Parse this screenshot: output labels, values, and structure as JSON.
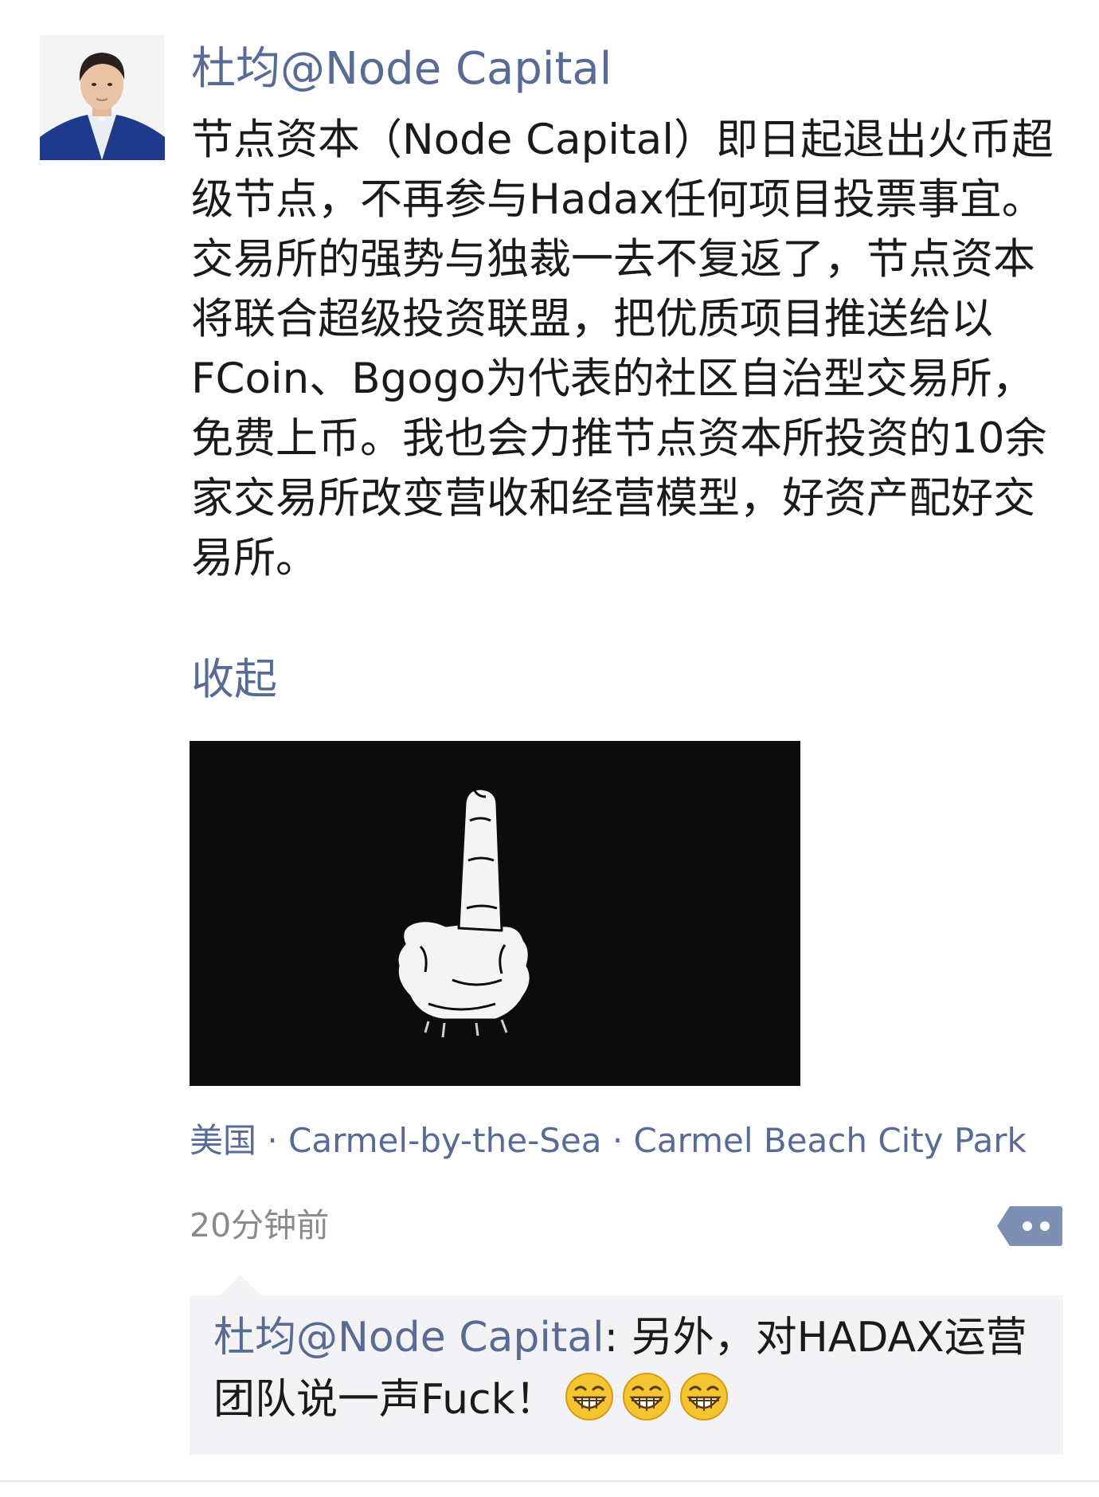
{
  "post": {
    "author": "杜均@Node Capital",
    "body": "节点资本（Node Capital）即日起退出火币超级节点，不再参与Hadax任何项目投票事宜。交易所的强势与独裁一去不复返了，节点资本将联合超级投资联盟，把优质项目推送给以FCoin、Bgogo为代表的社区自治型交易所，免费上币。我也会力推节点资本所投资的10余家交易所改变营收和经营模型，好资产配好交易所。",
    "collapse_label": "收起",
    "image_icon": "middle-finger-hand-drawing",
    "location": "美国 · Carmel-by-the-Sea · Carmel Beach City Park",
    "timestamp": "20分钟前",
    "more_icon": "comment-more-icon"
  },
  "comment": {
    "author": "杜均@Node Capital",
    "separator": ":",
    "text": " 另外，对HADAX运营团队说一声Fuck！",
    "emoji_icon": "grin-emoji-icon",
    "emoji_count": 3
  },
  "colors": {
    "link": "#576b95",
    "text": "#1a1a1a",
    "meta": "#8a8a8a",
    "comment_bg": "#f3f3f5",
    "image_bg": "#0c0c0c"
  }
}
